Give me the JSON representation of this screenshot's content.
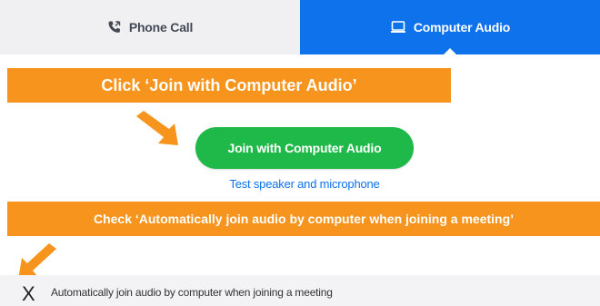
{
  "tabs": [
    {
      "label": "Phone Call",
      "icon": "phone-icon",
      "active": false
    },
    {
      "label": "Computer Audio",
      "icon": "monitor-icon",
      "active": true
    }
  ],
  "annotations": {
    "step1": "Click ‘Join with Computer Audio’",
    "step2": "Check ‘Automatically join audio by computer when joining a meeting’"
  },
  "join_button": {
    "label": "Join with Computer Audio"
  },
  "test_link": {
    "label": "Test speaker and microphone"
  },
  "auto_join": {
    "mark": "X",
    "label": "Automatically join audio by computer when joining a meeting",
    "checked": true
  },
  "colors": {
    "accent_blue": "#0e72ed",
    "join_green": "#1fb949",
    "annotation_orange": "#f7941d",
    "tab_inactive_bg": "#f0f0f2"
  }
}
